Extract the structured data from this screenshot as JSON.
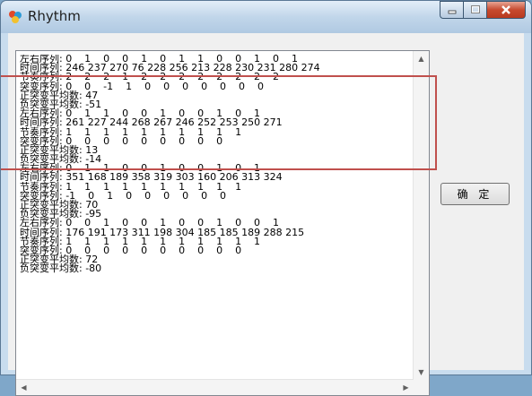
{
  "window": {
    "title": "Rhythm"
  },
  "button": {
    "ok_label": "确 定"
  },
  "lines": [
    "左右序列: 0    1    0    0    1    0    1    1    0    0    1    0    1",
    "时间序列: 246 237 270 76 228 256 213 228 230 231 280 274",
    "节奏序列: 2    2    2    1    2    2    2    2    2    2    2    2",
    "突变序列: 0    0    -1    1    0    0    0    0    0    0    0",
    "正突变平均数: 47",
    "负突变平均数: -51",
    "左右序列: 0    1    1    0    0    1    0    0    1    0    1",
    "时间序列: 261 227 244 268 267 246 252 253 250 271",
    "节奏序列: 1    1    1    1    1    1    1    1    1    1",
    "突变序列: 0    0    0    0    0    0    0    0    0",
    "正突变平均数: 13",
    "负突变平均数: -14",
    "左右序列: 0    1    1    0    0    1    0    0    1    0    1",
    "时间序列: 351 168 189 358 319 303 160 206 313 324",
    "节奏序列: 1    1    1    1    1    1    1    1    1    1",
    "突变序列: -1    0    1    0    0    0    0    0    0",
    "正突变平均数: 70",
    "负突变平均数: -95",
    "左右序列: 0    0    1    0    0    1    0    0    1    0    0    1",
    "时间序列: 176 191 173 311 198 304 185 185 189 288 215",
    "节奏序列: 1    1    1    1    1    1    1    1    1    1    1",
    "突变序列: 0    0    0    0    0    0    0    0    0    0",
    "正突变平均数: 72",
    "负突变平均数: -80"
  ],
  "colors": {
    "highlight": "#c0504d"
  }
}
